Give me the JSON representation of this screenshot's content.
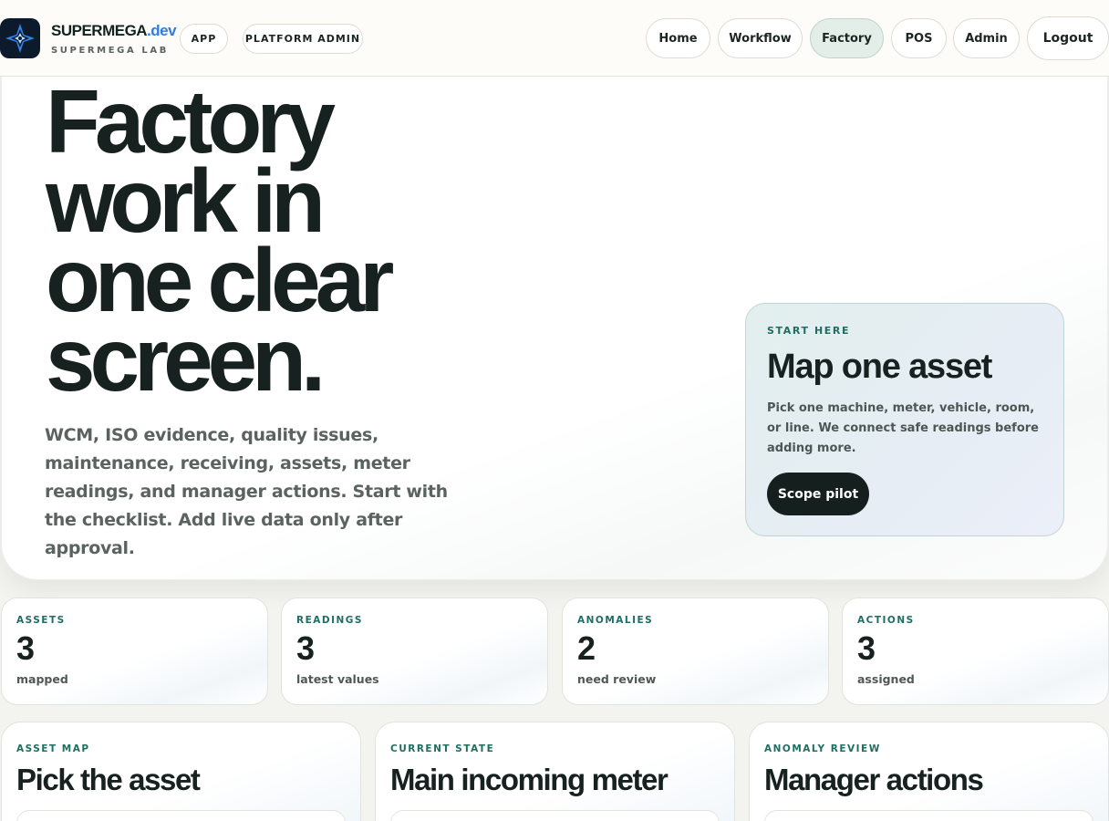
{
  "brand": {
    "name": "SUPERMEGA",
    "tld": ".dev",
    "subtitle": "SUPERMEGA LAB",
    "logo_icon": "compass-star-icon",
    "logo_bg": "#0d1a2c",
    "logo_accent": "#2f86e8"
  },
  "tags": {
    "app": "APP",
    "platform_admin": "PLATFORM ADMIN"
  },
  "nav": {
    "home": "Home",
    "workflow": "Workflow",
    "factory": "Factory",
    "pos": "POS",
    "admin": "Admin",
    "logout": "Logout",
    "active": "Factory"
  },
  "hero": {
    "title_lines": [
      "Factory",
      "work in",
      "one clear",
      "screen."
    ],
    "body": "WCM, ISO evidence, quality issues, maintenance, receiving, assets, meter readings, and manager actions. Start with the checklist. Add live data only after approval."
  },
  "start_card": {
    "eyebrow": "START HERE",
    "title": "Map one asset",
    "body": "Pick one machine, meter, vehicle, room, or line. We connect safe readings before adding more.",
    "button": "Scope pilot"
  },
  "stats": [
    {
      "label": "ASSETS",
      "value": "3",
      "sub": "mapped"
    },
    {
      "label": "READINGS",
      "value": "3",
      "sub": "latest values"
    },
    {
      "label": "ANOMALIES",
      "value": "2",
      "sub": "need review"
    },
    {
      "label": "ACTIONS",
      "value": "3",
      "sub": "assigned"
    }
  ],
  "panels": [
    {
      "eyebrow": "ASSET MAP",
      "title": "Pick the asset"
    },
    {
      "eyebrow": "CURRENT STATE",
      "title": "Main incoming meter"
    },
    {
      "eyebrow": "ANOMALY REVIEW",
      "title": "Manager actions"
    }
  ],
  "colors": {
    "accent_teal": "#1e6e63",
    "brand_blue": "#2f7de1",
    "ink": "#17211f",
    "active_nav": "#e3eee8"
  }
}
